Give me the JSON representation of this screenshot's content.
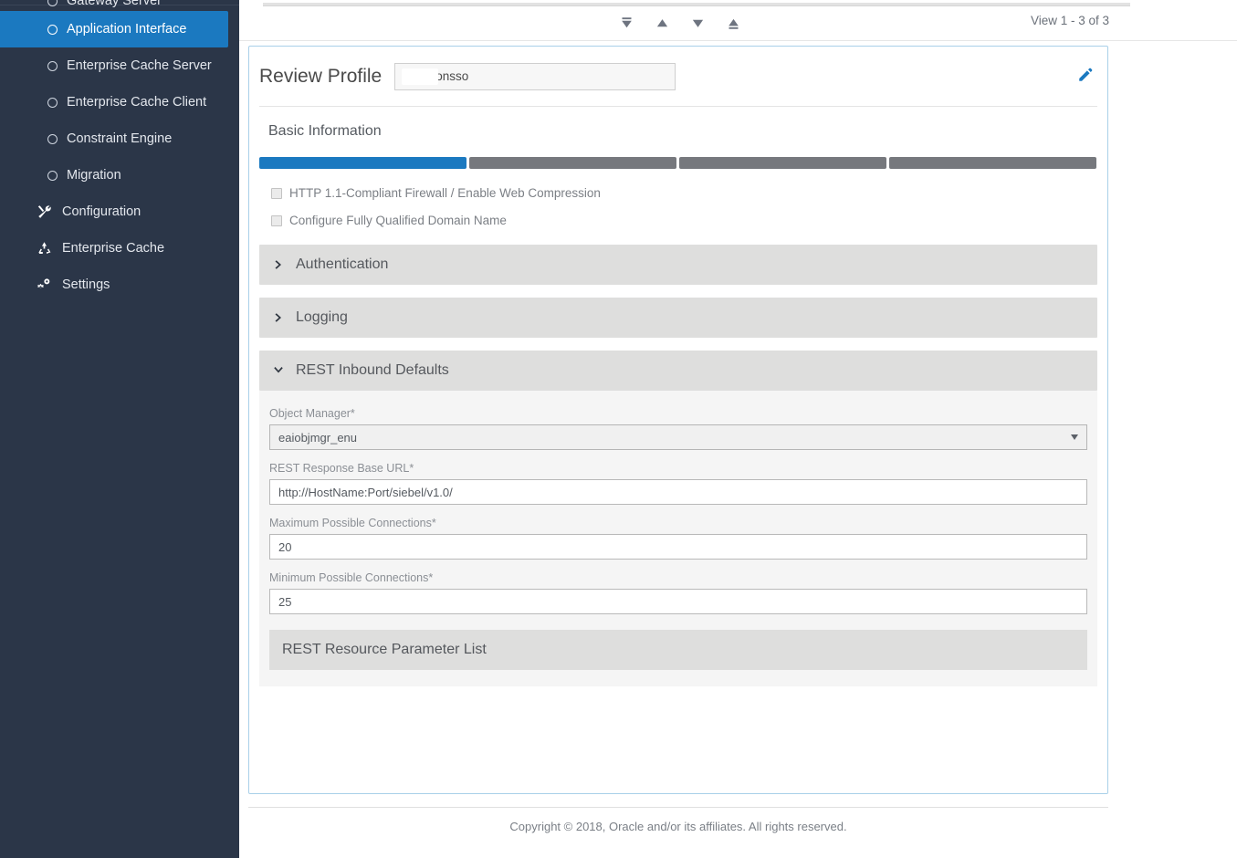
{
  "sidebar": {
    "clipped_item": {
      "label": "Gateway Server",
      "icon": "circle-bullet-icon"
    },
    "items": [
      {
        "label": "Application Interface",
        "icon": "circle-bullet-icon",
        "type": "sub",
        "active": true
      },
      {
        "label": "Enterprise Cache Server",
        "icon": "circle-bullet-icon",
        "type": "sub",
        "active": false
      },
      {
        "label": "Enterprise Cache Client",
        "icon": "circle-bullet-icon",
        "type": "sub",
        "active": false
      },
      {
        "label": "Constraint Engine",
        "icon": "circle-bullet-icon",
        "type": "sub",
        "active": false
      },
      {
        "label": "Migration",
        "icon": "circle-bullet-icon",
        "type": "sub",
        "active": false
      },
      {
        "label": "Configuration",
        "icon": "tools-icon",
        "type": "top",
        "active": false
      },
      {
        "label": "Enterprise Cache",
        "icon": "recycle-icon",
        "type": "top",
        "active": false
      },
      {
        "label": "Settings",
        "icon": "gears-icon",
        "type": "top",
        "active": false
      }
    ]
  },
  "pager": {
    "first_icon": "go-to-first-icon",
    "prev_icon": "go-to-previous-icon",
    "next_icon": "go-to-next-icon",
    "last_icon": "go-to-last-icon",
    "count_text": "View 1 - 3 of 3"
  },
  "card": {
    "title": "Review Profile",
    "profile_name": "_all_nonsso",
    "edit_icon": "pencil-edit-icon",
    "section_label": "Basic Information",
    "progress": {
      "total_segments": 4,
      "completed_segments": 1,
      "active_color": "#1b79c0",
      "inactive_color": "#76787d"
    },
    "checkboxes": [
      {
        "label": "HTTP 1.1-Compliant Firewall / Enable Web Compression",
        "checked": false
      },
      {
        "label": "Configure Fully Qualified Domain Name",
        "checked": false
      }
    ],
    "accordions": [
      {
        "label": "Authentication",
        "expanded": false,
        "icon": "chevron-right-icon"
      },
      {
        "label": "Logging",
        "expanded": false,
        "icon": "chevron-right-icon"
      },
      {
        "label": "REST Inbound Defaults",
        "expanded": true,
        "icon": "chevron-down-icon"
      }
    ],
    "rest_inbound_defaults": {
      "fields": [
        {
          "label": "Object Manager*",
          "value": "eaiobjmgr_enu",
          "control": "select"
        },
        {
          "label": "REST Response Base URL*",
          "value": "http://HostName:Port/siebel/v1.0/",
          "control": "text"
        },
        {
          "label": "Maximum Possible Connections*",
          "value": "20",
          "control": "text"
        },
        {
          "label": "Minimum Possible Connections*",
          "value": "25",
          "control": "text"
        }
      ],
      "sub_panel_label": "REST Resource Parameter List"
    }
  },
  "footer": {
    "copyright": "Copyright © 2018, Oracle and/or its affiliates. All rights reserved."
  }
}
